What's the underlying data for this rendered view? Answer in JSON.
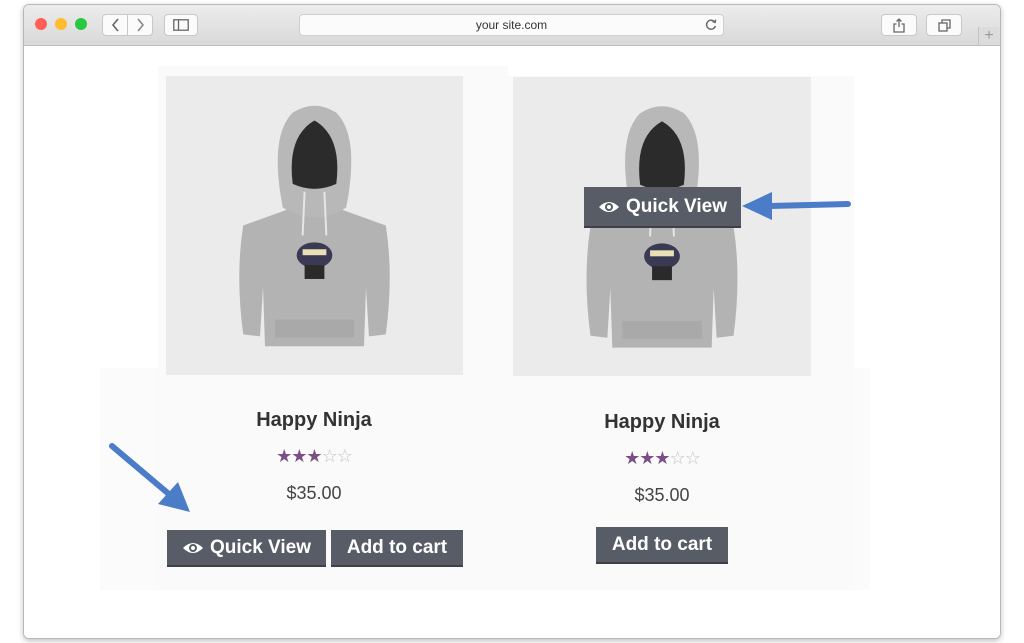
{
  "browser": {
    "url": "your site.com",
    "traffic_light_colors": [
      "#ff5f57",
      "#febc2e",
      "#28c840"
    ],
    "icons": [
      "back-chevron-icon",
      "forward-chevron-icon",
      "sidebar-icon",
      "reload-icon",
      "share-icon",
      "tabs-icon",
      "plus-icon"
    ]
  },
  "products": [
    {
      "title": "Happy Ninja",
      "rating": 3,
      "rating_max": 5,
      "price": "$35.00",
      "quick_view_label": "Quick View",
      "add_to_cart_label": "Add to cart"
    },
    {
      "title": "Happy Ninja",
      "rating": 3,
      "rating_max": 5,
      "price": "$35.00",
      "quick_view_label": "Quick View",
      "add_to_cart_label": "Add to cart"
    }
  ],
  "colors": {
    "button": "#585c67",
    "star": "#7b4f86",
    "annotation_arrow": "#4a7cc8"
  }
}
